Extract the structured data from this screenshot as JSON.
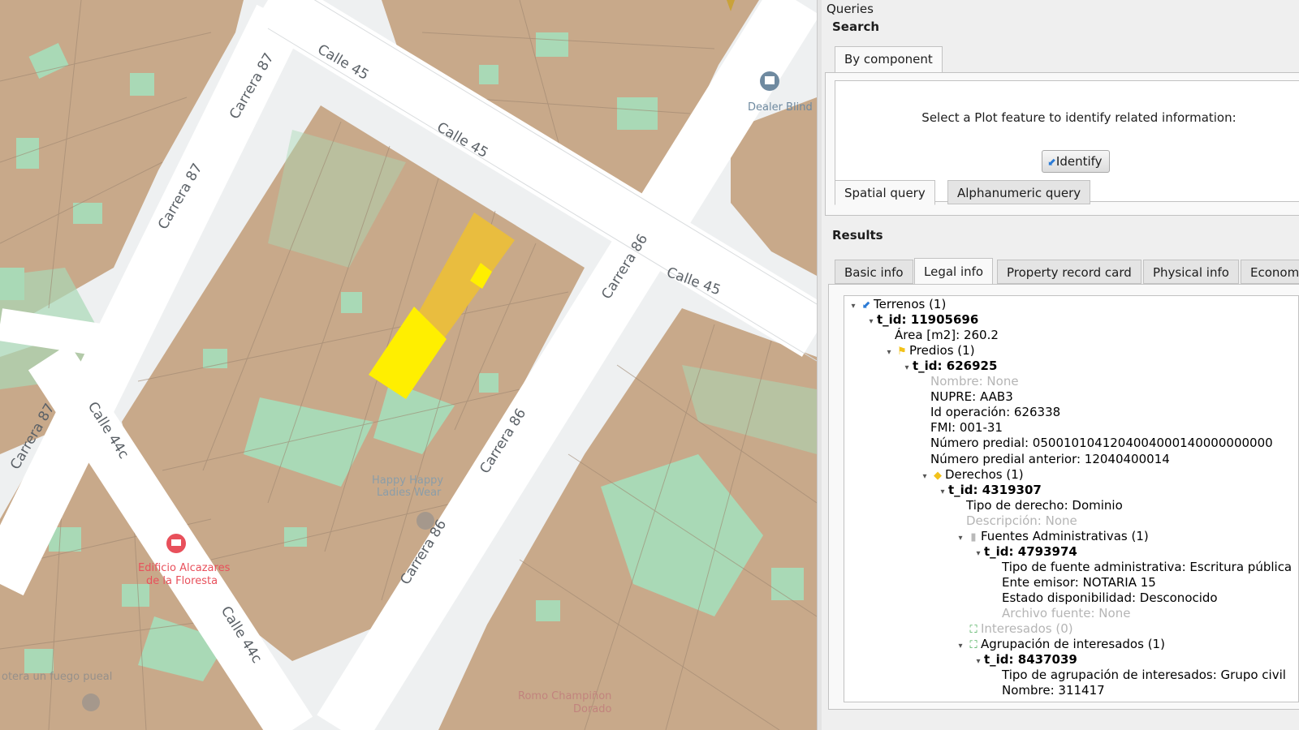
{
  "map": {
    "streets": [
      {
        "id": "calle-45-a",
        "text": "Calle 45"
      },
      {
        "id": "calle-45-b",
        "text": "Calle 45"
      },
      {
        "id": "calle-45-c",
        "text": "Calle 45"
      },
      {
        "id": "carrera-87-a",
        "text": "Carrera 87"
      },
      {
        "id": "carrera-87-b",
        "text": "Carrera 87"
      },
      {
        "id": "carrera-87-c",
        "text": "Carrera 87"
      },
      {
        "id": "calle-44c-a",
        "text": "Calle 44c"
      },
      {
        "id": "calle-44c-b",
        "text": "Calle 44c"
      },
      {
        "id": "carrera-86-a",
        "text": "Carrera 86"
      },
      {
        "id": "carrera-86-b",
        "text": "Carrera 86"
      },
      {
        "id": "carrera-86-c",
        "text": "Carrera 86"
      }
    ],
    "pois": {
      "dealer": "Dealer Blind",
      "happy_1": "Happy Happy",
      "happy_2": "Ladies Wear",
      "edificio_1": "Edificio Alcazares",
      "edificio_2": "de la Floresta",
      "bottom_left": "otera un fuego pueal",
      "bottom_center_1": "Romo Champiñon",
      "bottom_center_2": "Dorado"
    },
    "colors": {
      "parcel": "#c8a98a",
      "green": "#a9d9b6",
      "street": "#ffffff",
      "selected": "#ffef00",
      "selected_dark": "#e9bd3f"
    }
  },
  "panel": {
    "title": "Queries",
    "search": {
      "heading": "Search",
      "tab_label": "By component",
      "prompt": "Select a Plot feature to identify related information:",
      "identify_label": "Identify",
      "subtabs": [
        "Spatial query",
        "Alphanumeric query"
      ]
    },
    "results": {
      "heading": "Results",
      "tabs": [
        "Basic info",
        "Legal info",
        "Property record card",
        "Physical info",
        "Econom"
      ],
      "active_tab": "Legal info"
    },
    "tree": [
      {
        "level": 0,
        "arrow": "▾",
        "icon": "terreno-icon",
        "icon_char": "⬋",
        "icon_color": "#2b7bd6",
        "text": "Terrenos (1)",
        "style": ""
      },
      {
        "level": 1,
        "arrow": "▾",
        "icon": "",
        "text": "t_id: 11905696",
        "style": "b"
      },
      {
        "level": 2,
        "arrow": "",
        "icon": "",
        "text": "Área [m2]: 260.2",
        "style": ""
      },
      {
        "level": 2,
        "arrow": "▾",
        "icon": "predio-icon",
        "icon_char": "⚑",
        "icon_color": "#f2c21b",
        "text": "Predios (1)",
        "style": ""
      },
      {
        "level": 3,
        "arrow": "▾",
        "icon": "",
        "text": "t_id: 626925",
        "style": "b"
      },
      {
        "level": 4,
        "arrow": "",
        "icon": "",
        "text": "Nombre: None",
        "style": "muted"
      },
      {
        "level": 4,
        "arrow": "",
        "icon": "",
        "text": "NUPRE: AAB3",
        "style": ""
      },
      {
        "level": 4,
        "arrow": "",
        "icon": "",
        "text": "Id operación: 626338",
        "style": ""
      },
      {
        "level": 4,
        "arrow": "",
        "icon": "",
        "text": "FMI: 001-31",
        "style": ""
      },
      {
        "level": 4,
        "arrow": "",
        "icon": "",
        "text": "Número predial: 0500101041204004000140000000000",
        "style": ""
      },
      {
        "level": 4,
        "arrow": "",
        "icon": "",
        "text": "Número predial anterior: 12040400014",
        "style": ""
      },
      {
        "level": 4,
        "arrow": "▾",
        "icon": "derecho-icon",
        "icon_char": "◆",
        "icon_color": "#f2c21b",
        "text": "Derechos (1)",
        "style": ""
      },
      {
        "level": 5,
        "arrow": "▾",
        "icon": "",
        "text": "t_id: 4319307",
        "style": "b"
      },
      {
        "level": 6,
        "arrow": "",
        "icon": "",
        "text": "Tipo de derecho: Dominio",
        "style": ""
      },
      {
        "level": 6,
        "arrow": "",
        "icon": "",
        "text": "Descripción: None",
        "style": "muted"
      },
      {
        "level": 6,
        "arrow": "▾",
        "icon": "fuente-icon",
        "icon_char": "▮",
        "icon_color": "#b9b9b9",
        "text": "Fuentes Administrativas (1)",
        "style": ""
      },
      {
        "level": 7,
        "arrow": "▾",
        "icon": "",
        "text": "t_id: 4793974",
        "style": "b"
      },
      {
        "level": 8,
        "arrow": "",
        "icon": "",
        "text": "Tipo de fuente administrativa: Escritura pública",
        "style": ""
      },
      {
        "level": 8,
        "arrow": "",
        "icon": "",
        "text": "Ente emisor: NOTARIA 15",
        "style": ""
      },
      {
        "level": 8,
        "arrow": "",
        "icon": "",
        "text": "Estado disponibilidad: Desconocido",
        "style": ""
      },
      {
        "level": 8,
        "arrow": "",
        "icon": "",
        "text": "Archivo fuente: None",
        "style": "muted"
      },
      {
        "level": 6,
        "arrow": "",
        "icon": "interesado-icon",
        "icon_char": "⛶",
        "icon_color": "#3aa64a",
        "text": "Interesados (0)",
        "style": "muted"
      },
      {
        "level": 6,
        "arrow": "▾",
        "icon": "agrupacion-icon",
        "icon_char": "⛶",
        "icon_color": "#3aa64a",
        "text": "Agrupación de interesados (1)",
        "style": ""
      },
      {
        "level": 7,
        "arrow": "▾",
        "icon": "",
        "text": "t_id: 8437039",
        "style": "b"
      },
      {
        "level": 8,
        "arrow": "",
        "icon": "",
        "text": "Tipo de agrupación de interesados: Grupo civil",
        "style": ""
      },
      {
        "level": 8,
        "arrow": "",
        "icon": "",
        "text": "Nombre: 311417",
        "style": ""
      }
    ]
  }
}
